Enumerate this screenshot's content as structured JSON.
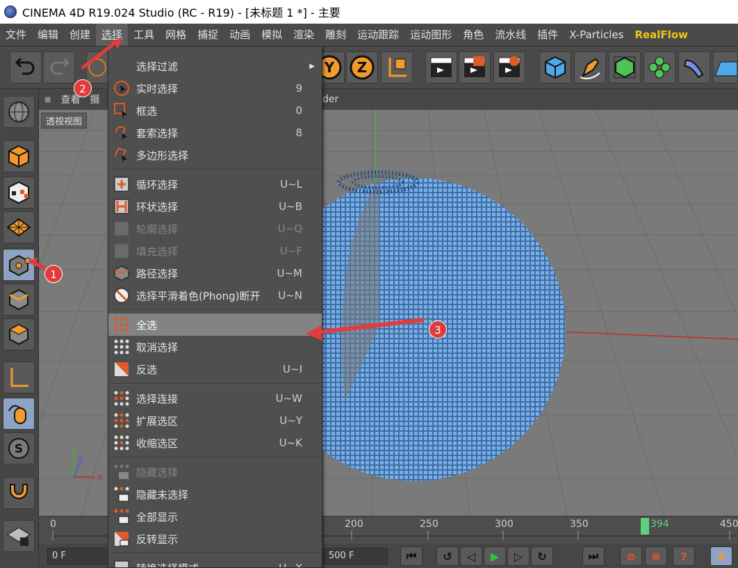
{
  "window": {
    "title": "CINEMA 4D R19.024 Studio (RC - R19) - [未标题 1 *] - 主要"
  },
  "menubar": {
    "items": [
      "文件",
      "编辑",
      "创建",
      "选择",
      "工具",
      "网格",
      "捕捉",
      "动画",
      "模拟",
      "渲染",
      "雕刻",
      "运动跟踪",
      "运动图形",
      "角色",
      "流水线",
      "插件",
      "X-Particles",
      "RealFlow"
    ],
    "active": "选择"
  },
  "viewport": {
    "tabs_left": [
      "查看",
      "摄"
    ],
    "tab_right": "der",
    "label": "透视视图"
  },
  "menu": {
    "items": [
      {
        "label": "选择过滤",
        "key": "",
        "submenu": true,
        "icon": "none",
        "disabled": false
      },
      {
        "label": "实时选择",
        "key": "9",
        "icon": "live-select-icon",
        "disabled": false
      },
      {
        "label": "框选",
        "key": "0",
        "icon": "box-select-icon",
        "disabled": false
      },
      {
        "label": "套索选择",
        "key": "8",
        "icon": "lasso-select-icon",
        "disabled": false
      },
      {
        "label": "多边形选择",
        "key": "",
        "icon": "polygon-select-icon",
        "disabled": false
      },
      {
        "label": "循环选择",
        "key": "U~L",
        "icon": "loop-select-icon",
        "disabled": false
      },
      {
        "label": "环状选择",
        "key": "U~B",
        "icon": "ring-select-icon",
        "disabled": false
      },
      {
        "label": "轮廓选择",
        "key": "U~Q",
        "icon": "outline-select-icon",
        "disabled": true
      },
      {
        "label": "填充选择",
        "key": "U~F",
        "icon": "fill-select-icon",
        "disabled": true
      },
      {
        "label": "路径选择",
        "key": "U~M",
        "icon": "path-select-icon",
        "disabled": false
      },
      {
        "label": "选择平滑着色(Phong)断开",
        "key": "U~N",
        "icon": "phong-break-icon",
        "disabled": false
      },
      {
        "label": "全选",
        "key": "",
        "icon": "select-all-icon",
        "disabled": false,
        "highlight": true
      },
      {
        "label": "取消选择",
        "key": "",
        "icon": "deselect-icon",
        "disabled": false
      },
      {
        "label": "反选",
        "key": "U~I",
        "icon": "invert-select-icon",
        "disabled": false
      },
      {
        "label": "选择连接",
        "key": "U~W",
        "icon": "select-connected-icon",
        "disabled": false
      },
      {
        "label": "扩展选区",
        "key": "U~Y",
        "icon": "grow-selection-icon",
        "disabled": false
      },
      {
        "label": "收缩选区",
        "key": "U~K",
        "icon": "shrink-selection-icon",
        "disabled": false
      },
      {
        "label": "隐藏选择",
        "key": "",
        "icon": "hide-selected-icon",
        "disabled": true
      },
      {
        "label": "隐藏未选择",
        "key": "",
        "icon": "hide-unselected-icon",
        "disabled": false
      },
      {
        "label": "全部显示",
        "key": "",
        "icon": "unhide-all-icon",
        "disabled": false
      },
      {
        "label": "反转显示",
        "key": "",
        "icon": "invert-visibility-icon",
        "disabled": false
      },
      {
        "label": "转换选择模式",
        "key": "U~X",
        "icon": "convert-selection-icon",
        "disabled": false
      }
    ]
  },
  "timeline": {
    "ticks": [
      "0",
      "200",
      "250",
      "300",
      "350",
      "450"
    ],
    "current_frame": "394",
    "start_field": "0 F",
    "end_field": "500 F"
  },
  "annotations": [
    "1",
    "2",
    "3"
  ],
  "colors": {
    "accent": "#f0c419",
    "badge": "#e23b3b",
    "mesh": "#4a8fd8",
    "highlight": "#838383"
  }
}
